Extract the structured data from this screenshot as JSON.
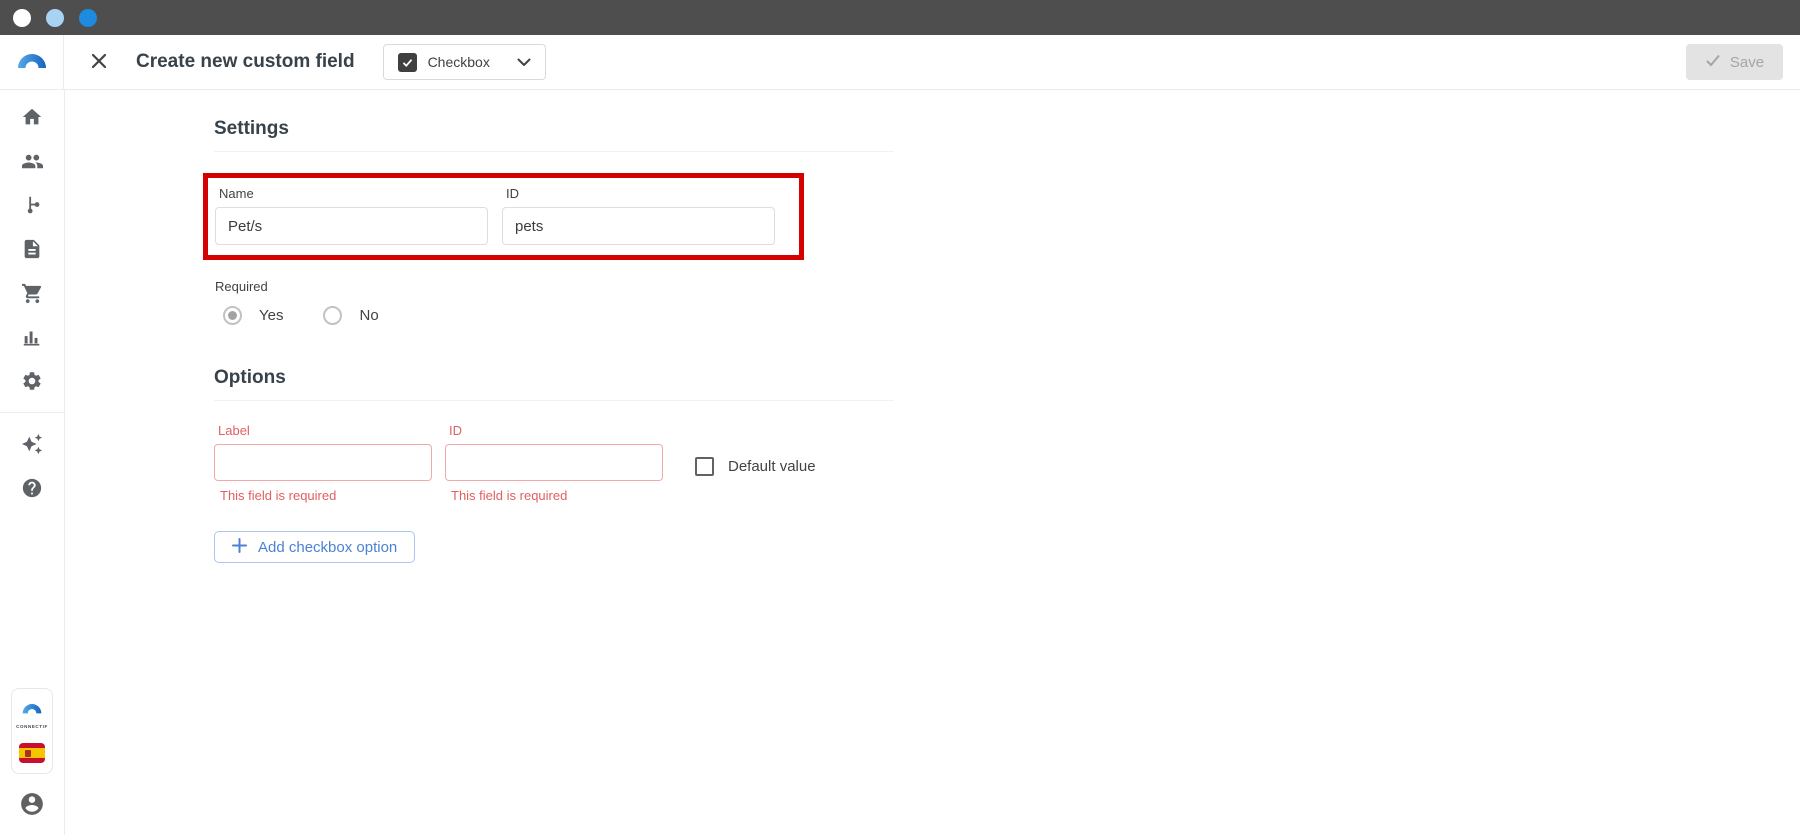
{
  "chrome": {
    "bar_color": "#4e4e4e",
    "dot_colors": [
      "#ffffff",
      "#a9d3f2",
      "#1d8be0"
    ]
  },
  "header": {
    "title": "Create new custom field",
    "field_type_dropdown": {
      "selected": "Checkbox"
    },
    "save_button": {
      "label": "Save",
      "enabled": false
    }
  },
  "sidebar": {
    "icons": [
      "home",
      "contacts",
      "flows",
      "documents",
      "store",
      "statistics",
      "settings",
      "ai-assistant",
      "help"
    ],
    "footer": {
      "brand": "CONNECTIF",
      "language_flag": "spanish-flag"
    }
  },
  "main": {
    "settings": {
      "heading": "Settings",
      "name_field": {
        "label": "Name",
        "value": "Pet/s"
      },
      "id_field": {
        "label": "ID",
        "value": "pets"
      },
      "required": {
        "label": "Required",
        "options": [
          {
            "label": "Yes",
            "selected": true
          },
          {
            "label": "No",
            "selected": false
          }
        ]
      }
    },
    "options": {
      "heading": "Options",
      "label_field": {
        "label": "Label",
        "value": "",
        "error": "This field is required"
      },
      "id_field": {
        "label": "ID",
        "value": "",
        "error": "This field is required"
      },
      "default_value": {
        "label": "Default value",
        "checked": false
      },
      "add_option_button": {
        "label": "Add checkbox option"
      }
    }
  },
  "annotation": {
    "highlight_color": "#d50000"
  }
}
